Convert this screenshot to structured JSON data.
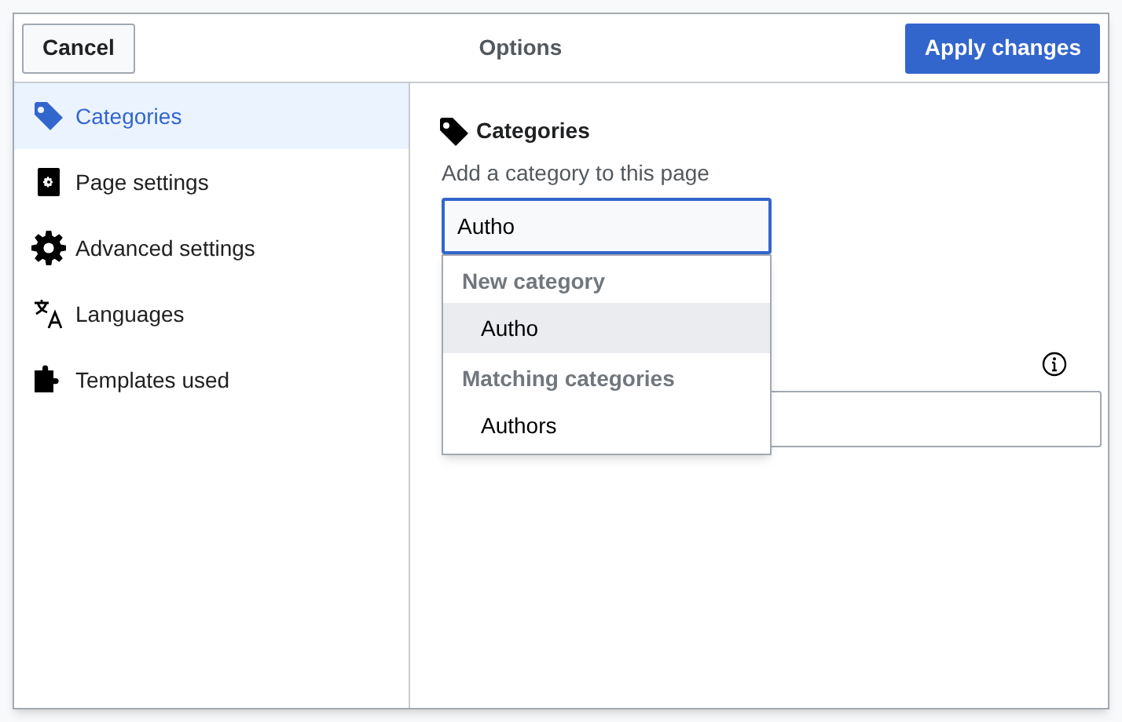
{
  "dialog": {
    "title": "Options",
    "cancel": "Cancel",
    "apply": "Apply changes"
  },
  "sidebar": {
    "items": [
      {
        "label": "Categories",
        "kind": "categories",
        "selected": true
      },
      {
        "label": "Page settings",
        "kind": "page",
        "selected": false
      },
      {
        "label": "Advanced settings",
        "kind": "advanced",
        "selected": false
      },
      {
        "label": "Languages",
        "kind": "languages",
        "selected": false
      },
      {
        "label": "Templates used",
        "kind": "templates",
        "selected": false
      }
    ]
  },
  "section": {
    "title": "Categories",
    "label": "Add a category to this page",
    "input": {
      "value": "Autho",
      "focused": true
    },
    "dropdown": {
      "groups": [
        {
          "heading": "New category",
          "items": [
            {
              "label": "Autho",
              "selected": true
            }
          ]
        },
        {
          "heading": "Matching categories",
          "items": [
            {
              "label": "Authors",
              "selected": false
            }
          ]
        }
      ]
    }
  }
}
